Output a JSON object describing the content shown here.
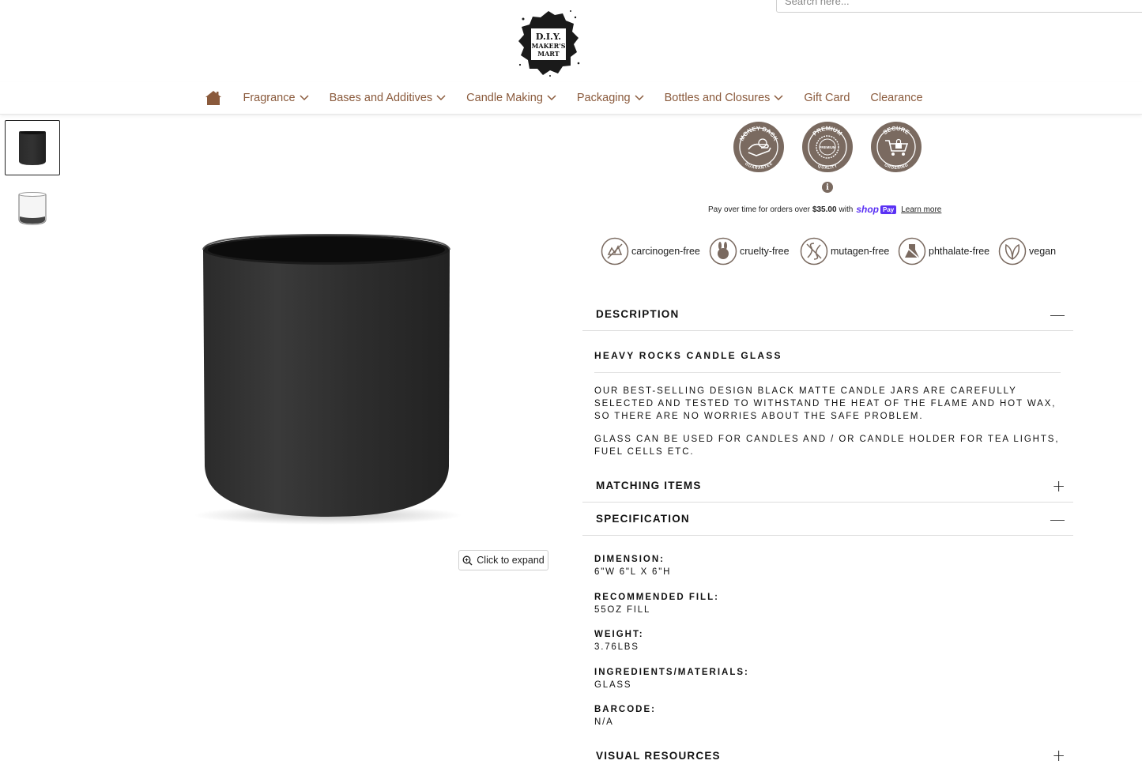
{
  "header": {
    "search_placeholder": "Search here...",
    "logo_text": [
      "D.I.Y.",
      "MAKER'S",
      "MART"
    ]
  },
  "nav": {
    "items": [
      {
        "label": "Fragrance",
        "dropdown": true
      },
      {
        "label": "Bases and Additives",
        "dropdown": true
      },
      {
        "label": "Candle Making",
        "dropdown": true
      },
      {
        "label": "Packaging",
        "dropdown": true
      },
      {
        "label": "Bottles and Closures",
        "dropdown": true
      },
      {
        "label": "Gift Card",
        "dropdown": false
      },
      {
        "label": "Clearance",
        "dropdown": false
      }
    ]
  },
  "gallery": {
    "expand_label": "Click to expand"
  },
  "badges": [
    {
      "top": "MONEY BACK",
      "bottom": "GUARANTEE"
    },
    {
      "top": "PREMIUM",
      "bottom": "QUALITY",
      "center": "PREMIUM"
    },
    {
      "top": "SECURE",
      "bottom": "ORDERING"
    }
  ],
  "installments": {
    "text": "Pay over time for orders over",
    "amount": "$35.00",
    "with": "with",
    "shop": "shop",
    "pay": "Pay",
    "learn_more": "Learn more"
  },
  "attributes": [
    {
      "label": "carcinogen-free",
      "icon": "hand-icon"
    },
    {
      "label": "cruelty-free",
      "icon": "rabbit-icon"
    },
    {
      "label": "mutagen-free",
      "icon": "dna-icon"
    },
    {
      "label": "phthalate-free",
      "icon": "flask-icon"
    },
    {
      "label": "vegan",
      "icon": "leaf-icon"
    }
  ],
  "description": {
    "title": "DESCRIPTION",
    "toggle": "—",
    "heading": "HEAVY ROCKS CANDLE GLASS",
    "paragraphs": [
      "OUR BEST-SELLING DESIGN BLACK MATTE CANDLE JARS ARE CAREFULLY SELECTED AND TESTED TO WITHSTAND THE HEAT OF THE FLAME AND HOT WAX, SO THERE ARE NO WORRIES ABOUT THE SAFE PROBLEM.",
      "GLASS CAN BE USED FOR CANDLES AND / OR CANDLE HOLDER FOR TEA LIGHTS, FUEL CELLS ETC."
    ]
  },
  "matching": {
    "title": "MATCHING ITEMS",
    "toggle": "+"
  },
  "specification": {
    "title": "SPECIFICATION",
    "toggle": "—",
    "rows": [
      {
        "label": "DIMENSION:",
        "value": "6\"W 6\"L X 6\"H"
      },
      {
        "label": "RECOMMENDED FILL:",
        "value": "55OZ FILL"
      },
      {
        "label": "WEIGHT:",
        "value": "3.76LBS"
      },
      {
        "label": "INGREDIENTS/MATERIALS:",
        "value": "GLASS"
      },
      {
        "label": "BARCODE:",
        "value": "N/A"
      }
    ]
  },
  "visual_resources": {
    "title": "VISUAL RESOURCES",
    "toggle": "+"
  },
  "colors": {
    "nav_text": "#8a5a3c",
    "badge": "#7a6a60",
    "shop_pay": "#5a31f4"
  }
}
